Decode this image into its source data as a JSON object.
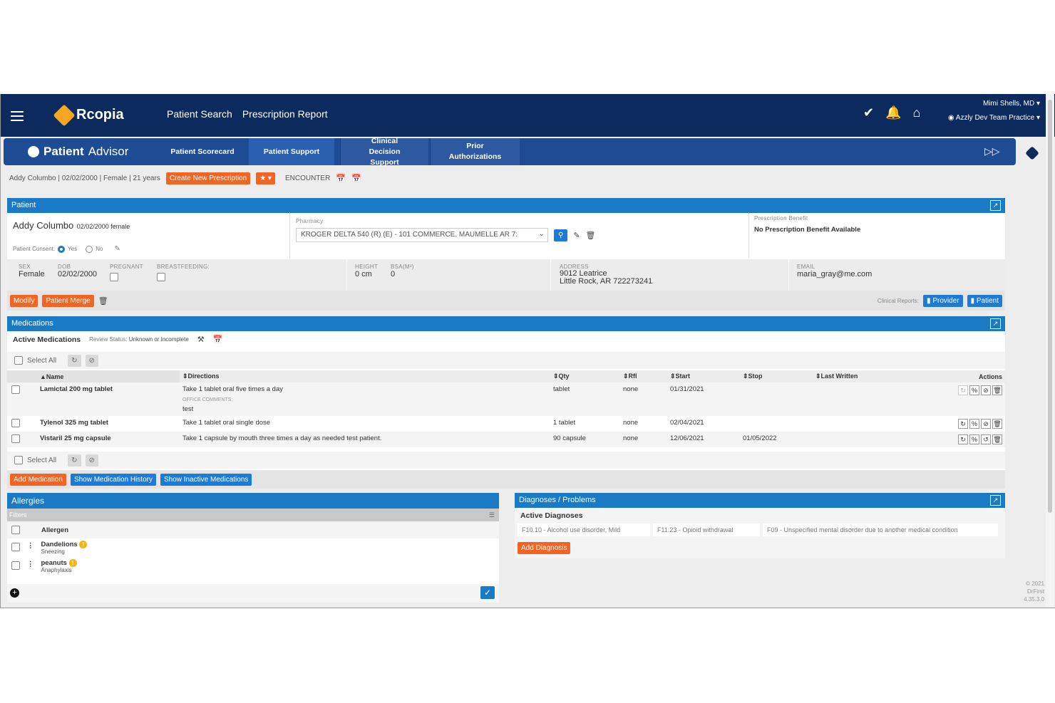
{
  "topbar": {
    "brand": "Rcopia",
    "nav": [
      "Patient Search",
      "Prescription Report"
    ],
    "user": "Mimi Shells, MD",
    "practice": "Azzly Dev Team Practice"
  },
  "pabar": {
    "brand_bold": "Patient",
    "brand_light": "Advisor",
    "tabs": [
      "Patient Scorecard",
      "Patient Support",
      "Clinical Decision Support",
      "Prior Authorizations"
    ]
  },
  "patline": {
    "info": "Addy Columbo | 02/02/2000 | Female | 21 years",
    "create": "Create New Prescription",
    "encounter": "ENCOUNTER"
  },
  "patient": {
    "header": "Patient",
    "name": "Addy Columbo",
    "meta": "02/02/2000 female",
    "consent_label": "Patient Consent:",
    "yes": "Yes",
    "no": "No",
    "pharmacy_label": "Pharmacy",
    "pharmacy_value": "KROGER DELTA 540 (R) (E) - 101 COMMERCE, MAUMELLE AR 7:",
    "benefit_label": "Prescription Benefit",
    "benefit_value": "No Prescription Benefit Available",
    "sex_label": "SEX",
    "sex": "Female",
    "dob_label": "DOB",
    "dob": "02/02/2000",
    "pregnant_label": "PREGNANT",
    "breast_label": "BREASTFEEDING:",
    "height_label": "HEIGHT",
    "height": "0 cm",
    "bsa_label": "BSA(M²)",
    "bsa": "0",
    "address_label": "ADDRESS",
    "address1": "9012 Leatrice",
    "address2": "Little Rock, AR 722273241",
    "email_label": "EMAIL",
    "email": "maria_gray@me.com",
    "modify": "Modify",
    "merge": "Patient Merge",
    "clinical_reports": "Clinical Reports:",
    "provider": "Provider",
    "patient_btn": "Patient"
  },
  "medications": {
    "header": "Medications",
    "active": "Active Medications",
    "review_label": "Review Status:",
    "review_value": "Unknown or Incomplete",
    "select_all": "Select All",
    "columns": {
      "name": "Name",
      "directions": "Directions",
      "qty": "Qty",
      "rfl": "Rfl",
      "start": "Start",
      "stop": "Stop",
      "last": "Last Written",
      "actions": "Actions"
    },
    "rows": [
      {
        "name": "Lamictal 200 mg tablet",
        "directions": "Take 1 tablet oral five times a day",
        "comments_label": "OFFICE COMMENTS:",
        "comments": "test",
        "qty": "tablet",
        "rfl": "none",
        "start": "01/31/2021",
        "stop": "",
        "last": ""
      },
      {
        "name": "Tylenol 325 mg tablet",
        "directions": "Take 1 tablet oral single dose",
        "qty": "1 tablet",
        "rfl": "none",
        "start": "02/04/2021",
        "stop": "",
        "last": ""
      },
      {
        "name": "Vistaril 25 mg capsule",
        "directions": "Take 1 capsule by mouth three times a day as needed test patient.",
        "qty": "90 capsule",
        "rfl": "none",
        "start": "12/06/2021",
        "stop": "01/05/2022",
        "last": ""
      }
    ],
    "add": "Add Medication",
    "history": "Show Medication History",
    "inactive": "Show Inactive Medications"
  },
  "allergies": {
    "header": "Allergies",
    "filters": "Filters",
    "col": "Allergen",
    "items": [
      {
        "name": "Dandelions",
        "reaction": "Sneezing"
      },
      {
        "name": "peanuts",
        "reaction": "Anaphylaxis"
      }
    ]
  },
  "diagnoses": {
    "header": "Diagnoses / Problems",
    "active": "Active Diagnoses",
    "items": [
      "F10.10 - Alcohol use disorder, Mild",
      "F11.23 - Opioid withdrawal",
      "F09 - Unspecified mental disorder due to another medical condition"
    ],
    "add": "Add Diagnosis"
  },
  "footer": [
    "© 2021",
    "DrFirst",
    "4.35.3.0"
  ]
}
